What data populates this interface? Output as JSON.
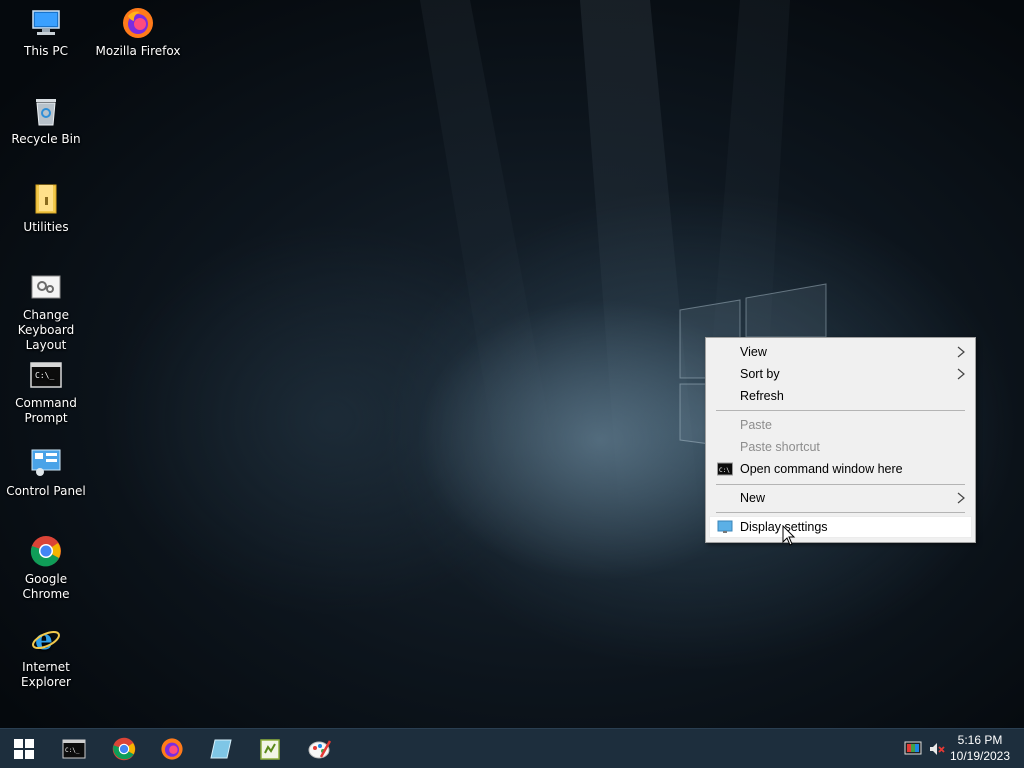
{
  "desktop": {
    "icons": [
      {
        "label": "This PC",
        "icon": "this-pc-icon"
      },
      {
        "label": "Mozilla Firefox",
        "icon": "firefox-icon"
      },
      {
        "label": "Recycle Bin",
        "icon": "recycle-bin-icon"
      },
      {
        "label": "Utilities",
        "icon": "folder-icon"
      },
      {
        "label": "Change Keyboard Layout",
        "icon": "keyboard-layout-icon"
      },
      {
        "label": "Command Prompt",
        "icon": "command-prompt-icon"
      },
      {
        "label": "Control Panel",
        "icon": "control-panel-icon"
      },
      {
        "label": "Google Chrome",
        "icon": "chrome-icon"
      },
      {
        "label": "Internet Explorer",
        "icon": "internet-explorer-icon"
      }
    ]
  },
  "context_menu": {
    "items": [
      {
        "label": "View",
        "submenu": true,
        "enabled": true
      },
      {
        "label": "Sort by",
        "submenu": true,
        "enabled": true
      },
      {
        "label": "Refresh",
        "submenu": false,
        "enabled": true
      },
      {
        "label": "Paste",
        "submenu": false,
        "enabled": false
      },
      {
        "label": "Paste shortcut",
        "submenu": false,
        "enabled": false
      },
      {
        "label": "Open command window here",
        "submenu": false,
        "enabled": true,
        "icon": "cmd-icon"
      },
      {
        "label": "New",
        "submenu": true,
        "enabled": true
      },
      {
        "label": "Display settings",
        "submenu": false,
        "enabled": true,
        "icon": "display-icon",
        "hovered": true
      }
    ]
  },
  "taskbar": {
    "buttons": [
      {
        "name": "start",
        "icon": "windows-start-icon"
      },
      {
        "name": "command-prompt",
        "icon": "command-prompt-icon"
      },
      {
        "name": "chrome",
        "icon": "chrome-icon"
      },
      {
        "name": "firefox",
        "icon": "firefox-icon"
      },
      {
        "name": "notes",
        "icon": "notes-icon"
      },
      {
        "name": "notepad-plus",
        "icon": "notepad-icon"
      },
      {
        "name": "paint",
        "icon": "paint-icon"
      }
    ],
    "clock": {
      "time": "5:16 PM",
      "date": "10/19/2023"
    }
  },
  "colors": {
    "taskbar": "#1d2e3d",
    "menu_bg": "#f0f0f0",
    "disabled_text": "#8d8d8d"
  }
}
